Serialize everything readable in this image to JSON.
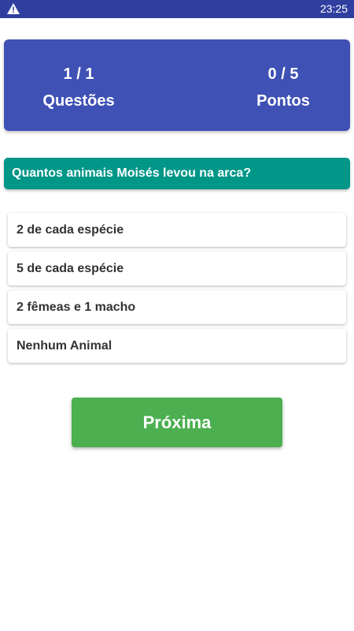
{
  "status_bar": {
    "time": "23:25",
    "icons": [
      "warning-icon"
    ]
  },
  "scoreboard": {
    "questions_value": "1 / 1",
    "questions_label": "Questões",
    "points_value": "0 / 5",
    "points_label": "Pontos"
  },
  "question": {
    "text": "Quantos animais Moisés levou na arca?"
  },
  "options": [
    {
      "label": "2 de cada espécie"
    },
    {
      "label": "5 de cada espécie"
    },
    {
      "label": "2 fêmeas e 1 macho"
    },
    {
      "label": "Nenhum Animal"
    }
  ],
  "next_button": {
    "label": "Próxima"
  },
  "colors": {
    "status_bar": "#303f9f",
    "scoreboard": "#3f51b5",
    "question": "#009688",
    "next_button": "#4caf50"
  }
}
